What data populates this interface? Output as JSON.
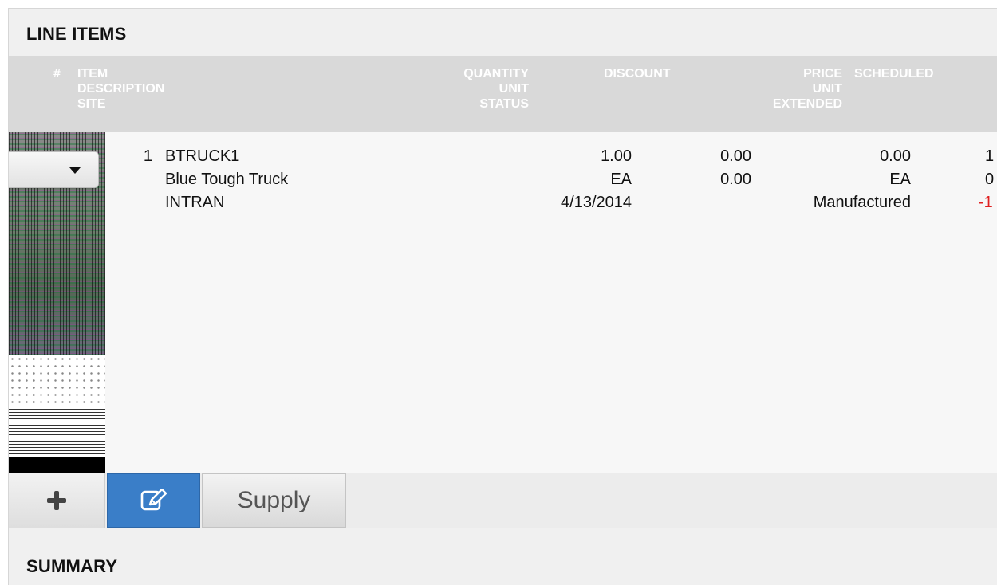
{
  "sections": {
    "line_items_title": "LINE ITEMS",
    "summary_title": "SUMMARY"
  },
  "header": {
    "num": "#",
    "item": [
      "ITEM",
      "DESCRIPTION",
      "SITE"
    ],
    "quantity": [
      "QUANTITY",
      "UNIT",
      "STATUS"
    ],
    "discount": "DISCOUNT",
    "price": [
      "PRICE",
      "UNIT",
      "EXTENDED"
    ],
    "scheduled": "SCHEDULED"
  },
  "rows": [
    {
      "line_number": "1",
      "item": "BTRUCK1",
      "description": "Blue Tough Truck",
      "site": "INTRAN",
      "quantity": "1.00",
      "unit": "EA",
      "status_date": "4/13/2014",
      "discount_1": "0.00",
      "discount_2": "0.00",
      "price": "0.00",
      "price_unit": "EA",
      "price_status": "Manufactured",
      "clipped_1": "1",
      "clipped_2": "0",
      "clipped_3": "-1"
    }
  ],
  "toolbar": {
    "supply_label": "Supply"
  },
  "icons": {
    "add": "plus-icon",
    "edit": "edit-icon",
    "row_menu": "caret-down-icon"
  },
  "colors": {
    "accent_blue": "#3a7ec8",
    "negative_red": "#e02020",
    "header_gray": "#d9d9d9"
  }
}
